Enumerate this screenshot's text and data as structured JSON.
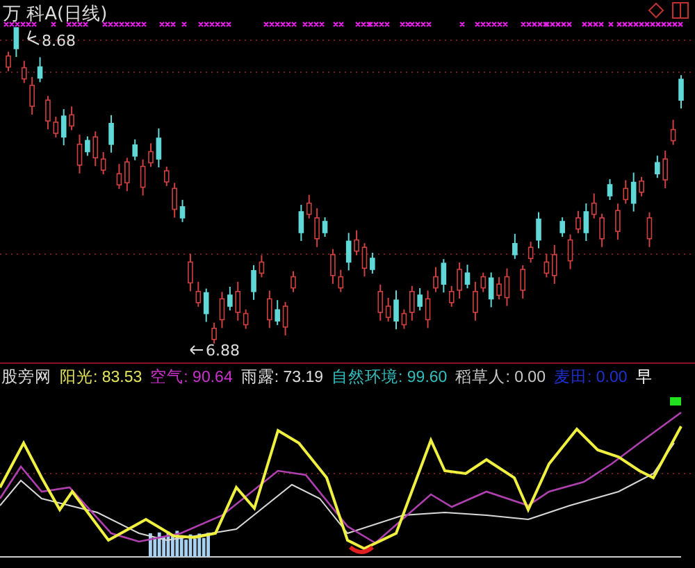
{
  "title": "万 科A(日线)",
  "high_label": "8.68",
  "low_label": "6.88",
  "indicator": {
    "name": "股旁网",
    "values": [
      {
        "label": "阳光:",
        "value": "83.53",
        "color": "#e8e860"
      },
      {
        "label": "空气:",
        "value": "90.64",
        "color": "#cc33cc"
      },
      {
        "label": "雨露:",
        "value": "73.19",
        "color": "#e0e0e0"
      },
      {
        "label": "自然环境:",
        "value": "99.60",
        "color": "#33c0c0"
      },
      {
        "label": "稻草人:",
        "value": "0.00",
        "color": "#c8c8c8"
      },
      {
        "label": "麦田:",
        "value": "0.00",
        "color": "#2030d0"
      },
      {
        "label": "早",
        "color": "#ffffff"
      }
    ]
  }
}
